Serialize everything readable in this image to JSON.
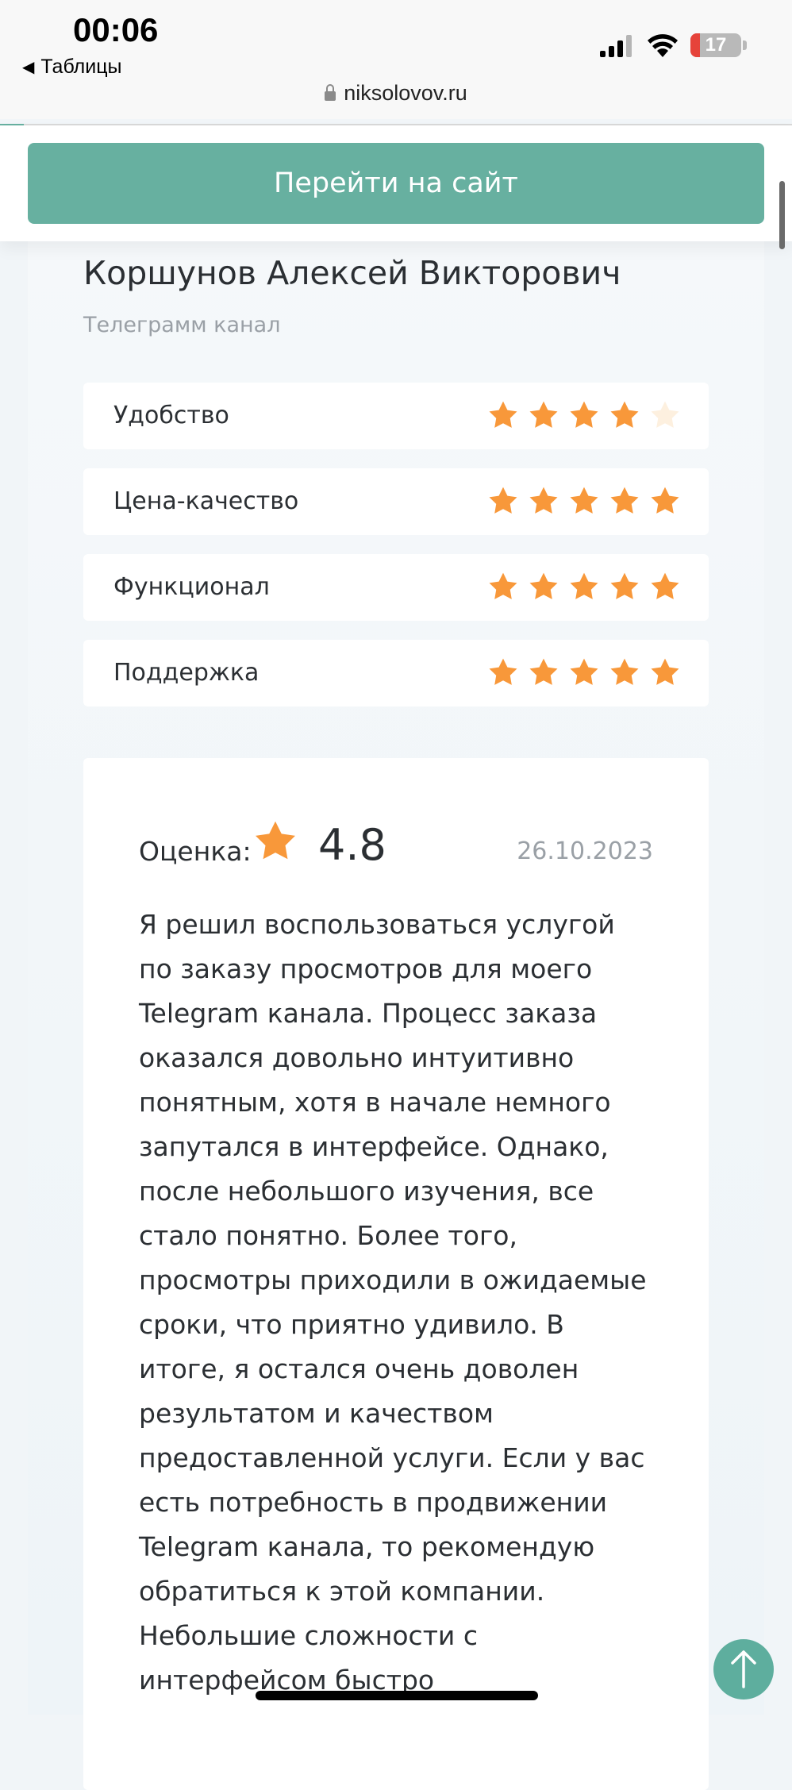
{
  "status_bar": {
    "time": "00:06",
    "back_app_label": "Таблицы",
    "battery_level": "17",
    "url": "niksolovov.ru"
  },
  "sticky": {
    "goto_button_label": "Перейти на сайт"
  },
  "review": {
    "author": "Коршунов Алексей Викторович",
    "source": "Телеграмм канал",
    "criteria": [
      {
        "label": "Удобство",
        "stars": 4
      },
      {
        "label": "Цена-качество",
        "stars": 5
      },
      {
        "label": "Функционал",
        "stars": 5
      },
      {
        "label": "Поддержка",
        "stars": 5
      }
    ],
    "score_label": "Оценка:",
    "score_value": "4.8",
    "date": "26.10.2023",
    "lines": [
      "Я решил воспользоваться услугой",
      "по заказу просмотров для моего",
      "Telegram канала. Процесс заказа",
      "оказался довольно интуитивно",
      "понятным, хотя в начале немного",
      "запутался в интерфейсе. Однако,",
      "после небольшого изучения, все",
      "стало понятно. Более того,",
      "просмотры приходили в ожидаемые",
      "сроки, что приятно удивило. В",
      "итоге, я остался очень доволен",
      "результатом и качеством",
      "предоставленной услуги. Если у вас",
      "есть потребность в продвижении",
      "Telegram канала, то рекомендую",
      "обратиться к этой компании.",
      "Небольшие сложности с",
      "интерфейсом быстро"
    ]
  },
  "colors": {
    "accent": "#67b0a0",
    "star_filled": "#f8983a",
    "star_empty": "#fdf0df"
  }
}
